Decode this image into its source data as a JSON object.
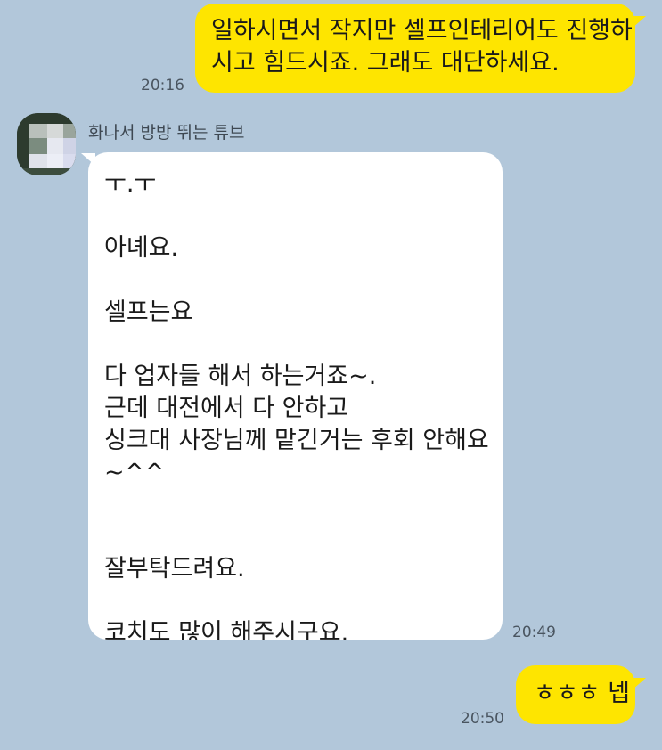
{
  "messages": {
    "m1": {
      "lines": [
        "일하시면서 작지만 셀프인테리어도 진행하",
        "시고 힘드시죠. 그래도 대단하세요."
      ],
      "time": "20:16"
    },
    "sender_name": "화나서 방방 뛰는 튜브",
    "m2": {
      "lines": [
        "ㅜ.ㅜ",
        "",
        "아녜요.",
        "",
        "셀프는요",
        "",
        "다 업자들 해서 하는거죠~.",
        "근데 대전에서 다 안하고",
        "싱크대 사장님께 맡긴거는 후회 안해요",
        "~^^",
        "",
        "",
        "잘부탁드려요.",
        "",
        "코치도 많이 해주시구요."
      ],
      "time": "20:49"
    },
    "m3": {
      "text": "ㅎㅎㅎ 넵",
      "time": "20:50"
    }
  },
  "colors": {
    "background": "#b2c7da",
    "my_bubble": "#fee500",
    "their_bubble": "#ffffff"
  },
  "icons": {
    "avatar": "profile-avatar-pixelated"
  }
}
